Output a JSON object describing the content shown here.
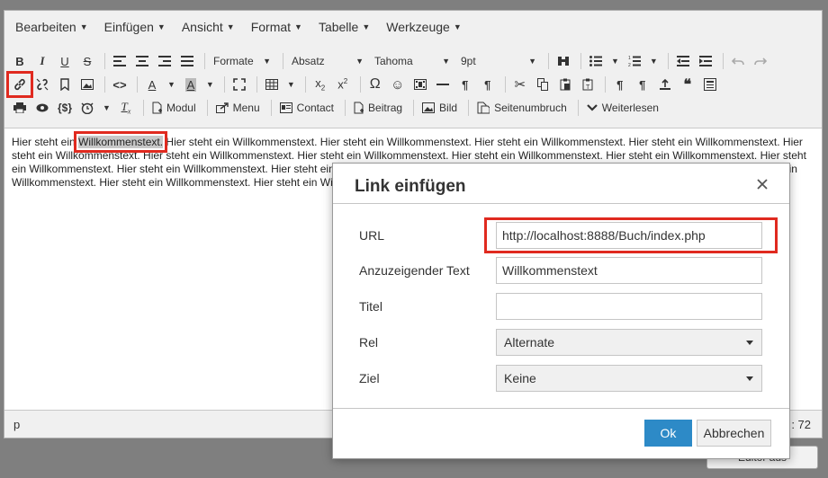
{
  "menubar": [
    "Bearbeiten",
    "Einfügen",
    "Ansicht",
    "Format",
    "Tabelle",
    "Werkzeuge"
  ],
  "toolbar": {
    "formats_label": "Formate",
    "block_format": "Absatz",
    "font_family": "Tahoma",
    "font_size": "9pt",
    "modul": "Modul",
    "menu": "Menu",
    "contact": "Contact",
    "beitrag": "Beitrag",
    "bild": "Bild",
    "seitenumbruch": "Seitenumbruch",
    "weiterlesen": "Weiterlesen"
  },
  "content": {
    "before": "Hier steht ein ",
    "selected": "Willkommenstext.",
    "after": " Hier steht ein Willkommenstext. Hier steht ein Willkommenstext. Hier steht ein Willkommenstext. Hier steht ein Willkommenstext. Hier steht ein Willkommenstext. Hier steht ein Willkommenstext. Hier steht ein Willkommenstext. Hier steht ein Willkommenstext. Hier steht ein Willkommenstext. Hier steht ein Willkommenstext. Hier steht ein Willkommenstext. Hier steht ein Willkommenstext. Hier steht ein Willkommenstext. Hier steht ein Willkommenstext. Hier steht ein Willkommenstext. Hier steht ein Willkommenstext. Hier steht ein Willkommenstext. Hier steht ein W"
  },
  "statusbar": {
    "path": "p",
    "count": ": 72"
  },
  "close_editor": "Editor aus",
  "dialog": {
    "title": "Link einfügen",
    "url_label": "URL",
    "url_value": "http://localhost:8888/Buch/index.php",
    "text_label": "Anzuzeigender Text",
    "text_value": "Willkommenstext",
    "title_label": "Titel",
    "title_value": "",
    "rel_label": "Rel",
    "rel_value": "Alternate",
    "target_label": "Ziel",
    "target_value": "Keine",
    "ok": "Ok",
    "cancel": "Abbrechen"
  },
  "colors": {
    "accent": "#2d8ac7",
    "highlight": "#e02a1f"
  }
}
